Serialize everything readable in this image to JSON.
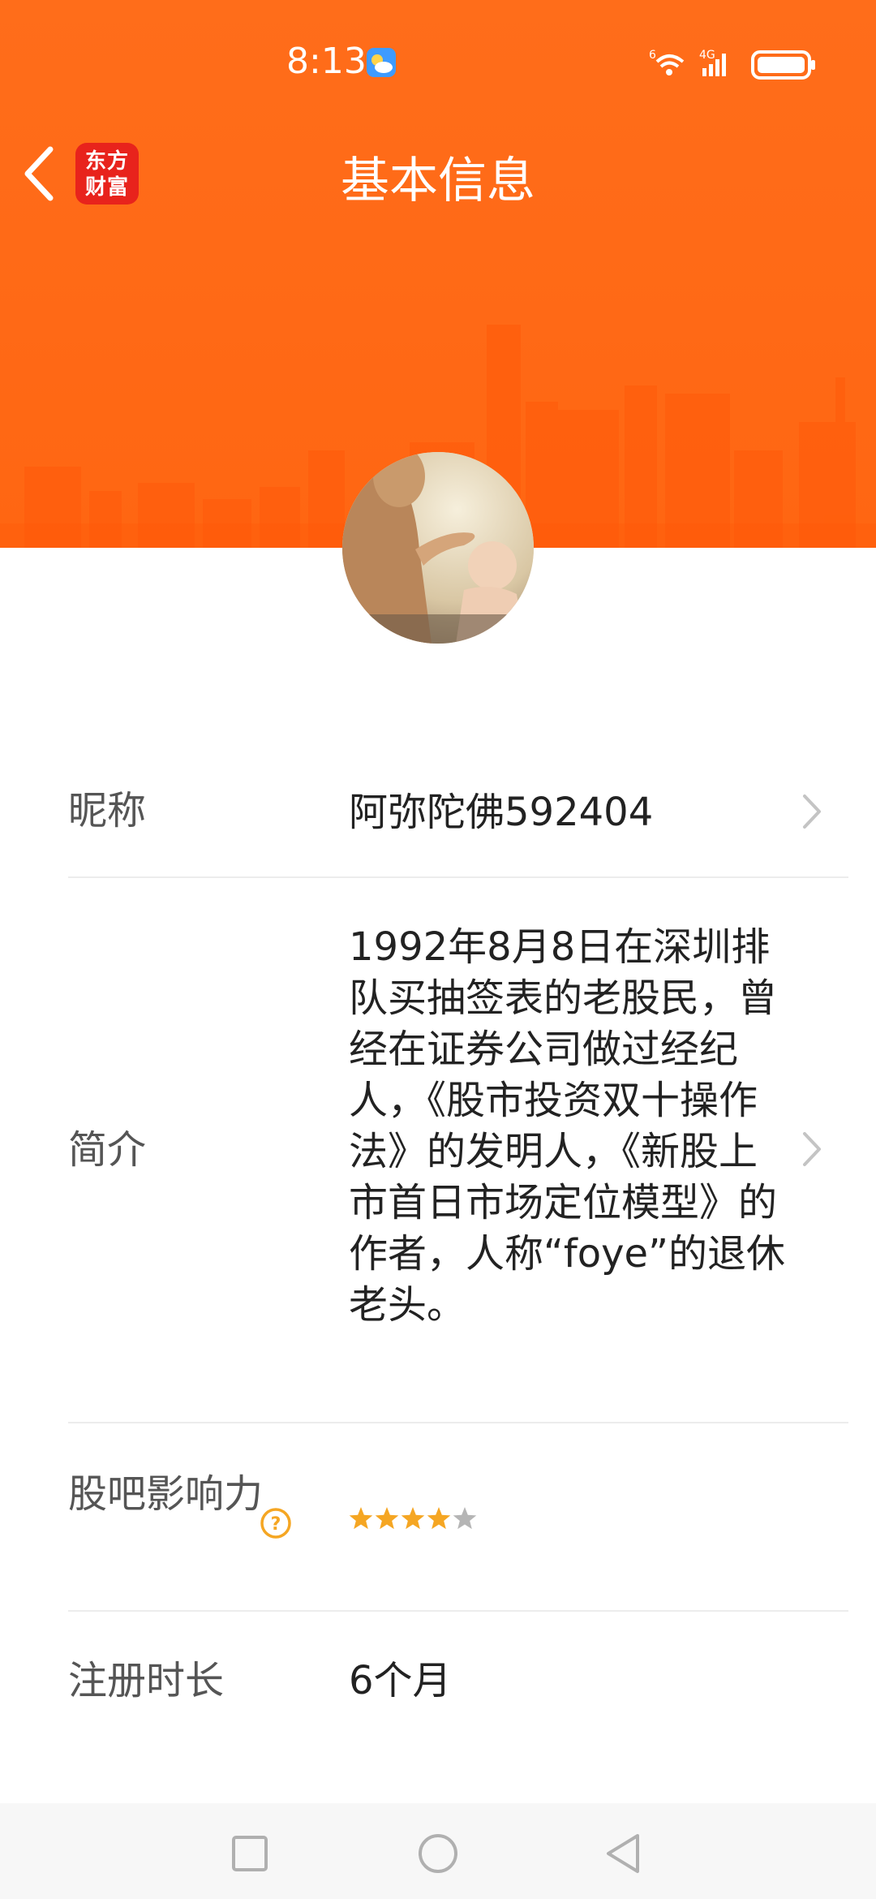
{
  "status_bar": {
    "time": "8:13",
    "network_label": "4G",
    "wifi_label": "6"
  },
  "header": {
    "title": "基本信息",
    "logo_line1": "东方",
    "logo_line2": "财富"
  },
  "profile": {
    "nickname_label": "昵称",
    "nickname": "阿弥陀佛592404",
    "bio_label": "简介",
    "bio": "1992年8月8日在深圳排队买抽签表的老股民，曾经在证券公司做过经纪人，《股市投资双十操作法》的发明人，《新股上市首日市场定位模型》的作者，人称“foye”的退休老头。",
    "influence_label": "股吧影响力",
    "influence_rating": 4,
    "influence_max": 5,
    "registration_label": "注册时长",
    "registration_value": "6个月"
  },
  "colors": {
    "brand": "#ff6a17",
    "logo_red": "#e8231c",
    "star_filled": "#f5a623",
    "star_empty": "#b5b5b5",
    "help_icon": "#f5a623"
  },
  "icons": {
    "back": "chevron-left-icon",
    "row_arrow": "chevron-right-icon",
    "help": "question-circle-icon",
    "recent_apps": "square-icon",
    "home": "circle-icon",
    "back_nav": "triangle-left-icon"
  }
}
